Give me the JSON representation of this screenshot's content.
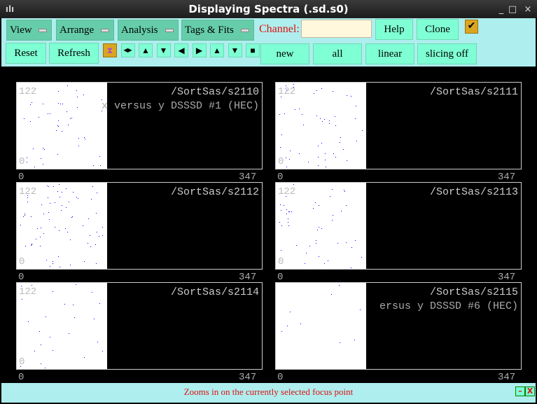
{
  "window": {
    "title": "Displaying Spectra (.sd.s0)",
    "minimize": "_",
    "maximize": "□",
    "close": "×"
  },
  "menus": [
    {
      "label": "View"
    },
    {
      "label": "Arrange"
    },
    {
      "label": "Analysis"
    },
    {
      "label": "Tags & Fits"
    }
  ],
  "channel": {
    "label": "Channel:",
    "value": ""
  },
  "buttons": {
    "help": "Help",
    "clone": "Clone",
    "reset": "Reset",
    "refresh": "Refresh",
    "new": "new",
    "all": "all",
    "linear": "linear",
    "slicing": "slicing off",
    "check": "✔"
  },
  "icon_buttons": [
    {
      "icon": "zoom-focus-icon",
      "glyph": "⧗"
    },
    {
      "icon": "expand-horizontal-icon",
      "glyph": "◀▶"
    },
    {
      "icon": "expand-vertical-icon",
      "glyph": "▲"
    },
    {
      "icon": "shrink-vertical-icon",
      "glyph": "▼"
    },
    {
      "icon": "scroll-left-icon",
      "glyph": "◀"
    },
    {
      "icon": "scroll-right-icon",
      "glyph": "▶"
    },
    {
      "icon": "scroll-up-icon",
      "glyph": "▲"
    },
    {
      "icon": "scroll-down-icon",
      "glyph": "▼"
    },
    {
      "icon": "full-view-icon",
      "glyph": "■"
    }
  ],
  "panels": [
    {
      "name": "/SortSas/s2110",
      "subtitle": "x versus y DSSSD #1 (HEC)",
      "ymax": "122",
      "ymin": "0",
      "xmin": "0",
      "xmax": "347",
      "dots": 45
    },
    {
      "name": "/SortSas/s2111",
      "subtitle": "",
      "ymax": "122",
      "ymin": "0",
      "xmin": "0",
      "xmax": "347",
      "dots": 50
    },
    {
      "name": "/SortSas/s2112",
      "subtitle": "",
      "ymax": "122",
      "ymin": "0",
      "xmin": "0",
      "xmax": "347",
      "dots": 70
    },
    {
      "name": "/SortSas/s2113",
      "subtitle": "",
      "ymax": "122",
      "ymin": "0",
      "xmin": "0",
      "xmax": "347",
      "dots": 45
    },
    {
      "name": "/SortSas/s2114",
      "subtitle": "",
      "ymax": "122",
      "ymin": "0",
      "xmin": "0",
      "xmax": "347",
      "dots": 25
    },
    {
      "name": "/SortSas/s2115",
      "subtitle": "ersus y DSSSD #6 (HEC)",
      "ymax": "",
      "ymin": "",
      "xmin": "0",
      "xmax": "347",
      "dots": 9
    }
  ],
  "status": {
    "text": "Zooms in on the currently selected focus point",
    "min": "–",
    "close": "X"
  },
  "colors": {
    "toolbar": "#aeeeee",
    "menu": "#66cdaa",
    "button": "#7fffd4",
    "channel_label": "#e01010",
    "dots": "#0000ff"
  }
}
